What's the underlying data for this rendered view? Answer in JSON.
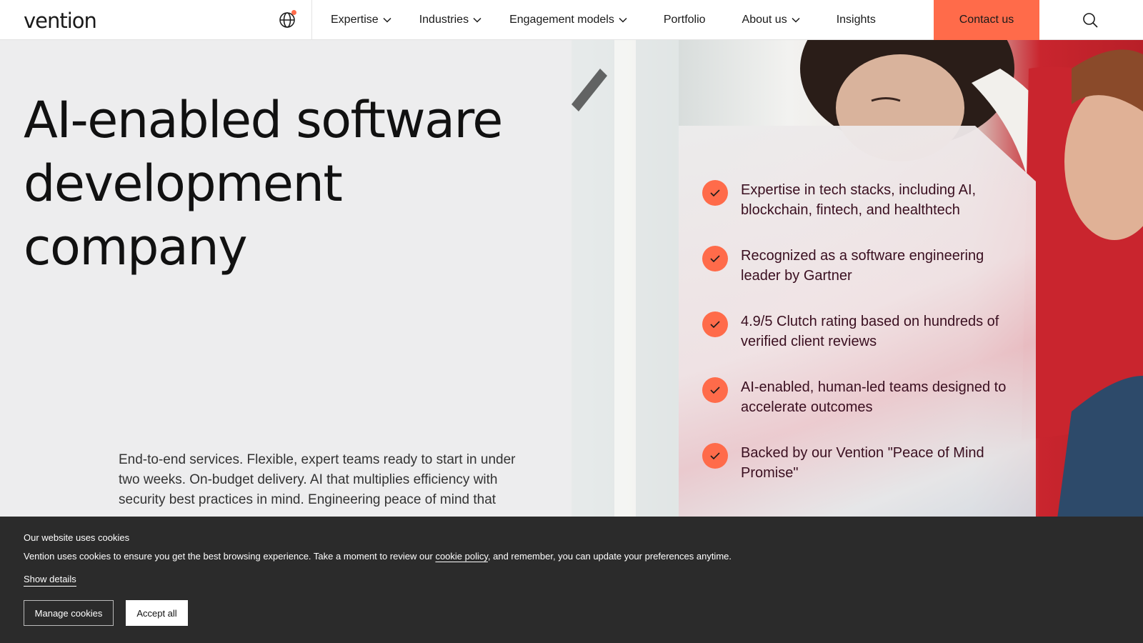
{
  "header": {
    "logo": "vention",
    "nav": [
      {
        "label": "Expertise",
        "dropdown": true
      },
      {
        "label": "Industries",
        "dropdown": true
      },
      {
        "label": "Engagement models",
        "dropdown": true
      },
      {
        "label": "Portfolio",
        "dropdown": false
      },
      {
        "label": "About us",
        "dropdown": true
      },
      {
        "label": "Insights",
        "dropdown": false
      }
    ],
    "contact_label": "Contact us",
    "icons": {
      "globe": "globe-icon",
      "search": "search-icon"
    }
  },
  "hero": {
    "title_lines": [
      "AI-enabled software",
      "development",
      "company"
    ],
    "description": "End-to-end services. Flexible, expert teams ready to start in under two weeks. On-budget delivery. AI that multiplies efficiency with security best practices in mind. Engineering peace of mind that",
    "bullets": [
      "Expertise in tech stacks, including AI, blockchain, fintech, and healthtech",
      "Recognized as a software engineering leader by Gartner",
      "4.9/5 Clutch rating based on hundreds of verified client reviews",
      "AI-enabled, human-led teams designed to accelerate outcomes",
      "Backed by our Vention \"Peace of Mind Promise\""
    ]
  },
  "cookie": {
    "title": "Our website uses cookies",
    "text_before": "Vention uses cookies to ensure you get the best browsing experience. Take a moment to review our ",
    "link": "cookie policy",
    "text_after": ", and remember, you can update your preferences anytime.",
    "show_details": "Show details",
    "manage_label": "Manage cookies",
    "accept_label": "Accept all"
  },
  "colors": {
    "accent": "#ff6b4a",
    "cookie_bg": "#2b2b2b",
    "bullet_text": "#3a0f20"
  }
}
